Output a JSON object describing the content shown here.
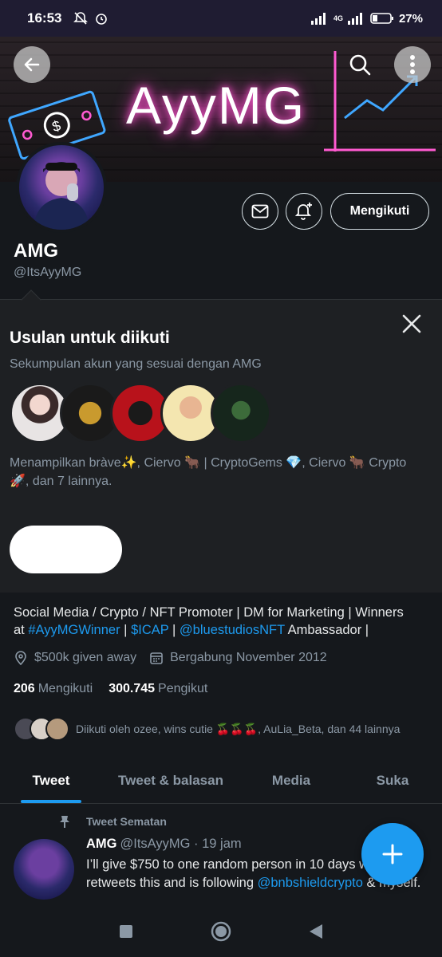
{
  "status_bar": {
    "time": "16:53",
    "battery": "27%",
    "network": "4G"
  },
  "banner": {
    "title": "AyyMG"
  },
  "profile": {
    "display_name": "AMG",
    "handle": "@ItsAyyMG",
    "follow_label": "Mengikuti"
  },
  "suggestions": {
    "title": "Usulan untuk diikuti",
    "subtitle": "Sekumpulan akun yang sesuai dengan AMG",
    "description": "Menampilkan bràve✨, Ciervo 🐂 | CryptoGems 💎, Ciervo 🐂 Crypto 🚀, dan 7 lainnya.",
    "avatars": [
      {
        "name": "avatar-girl",
        "color": "#d9d4d4"
      },
      {
        "name": "avatar-gold-logo",
        "color": "#1a1a1a"
      },
      {
        "name": "avatar-red-deer",
        "color": "#b8121b"
      },
      {
        "name": "avatar-smiling-man",
        "color": "#f4e6b0"
      },
      {
        "name": "avatar-hooded",
        "color": "#1e3a2a"
      }
    ]
  },
  "bio": {
    "line1": "Social Media / Crypto / NFT Promoter | DM for Marketing  | Winners",
    "at": "at ",
    "tag1": "#AyyMGWinner",
    "sep1": " | ",
    "tag2": "$ICAP",
    "sep2": " | ",
    "tag3": "@bluestudiosNFT",
    "tail": " Ambassador |"
  },
  "meta": {
    "location": "$500k given away",
    "joined": "Bergabung November 2012"
  },
  "counts": {
    "following_num": "206",
    "following_label": "Mengikuti",
    "followers_num": "300.745",
    "followers_label": "Pengikut"
  },
  "followed_by": "Diikuti oleh ozee, wins cutie 🍒🍒🍒, AuLia_Beta, dan 44 lainnya",
  "tabs": [
    {
      "label": "Tweet"
    },
    {
      "label": "Tweet & balasan"
    },
    {
      "label": "Media"
    },
    {
      "label": "Suka"
    }
  ],
  "tweet": {
    "pinned_label": "Tweet Sematan",
    "name": "AMG",
    "meta": "@ItsAyyMG · 19 jam",
    "text_a": "I’ll give $750 to one random person in 10 days who",
    "text_b": "retweets this and is following ",
    "mention": "@bnbshieldcrypto",
    "text_c": " & myself."
  },
  "colors": {
    "accent": "#1d9bf0",
    "background": "#15181c",
    "panel": "#1e2023",
    "muted": "#8b98a5"
  }
}
